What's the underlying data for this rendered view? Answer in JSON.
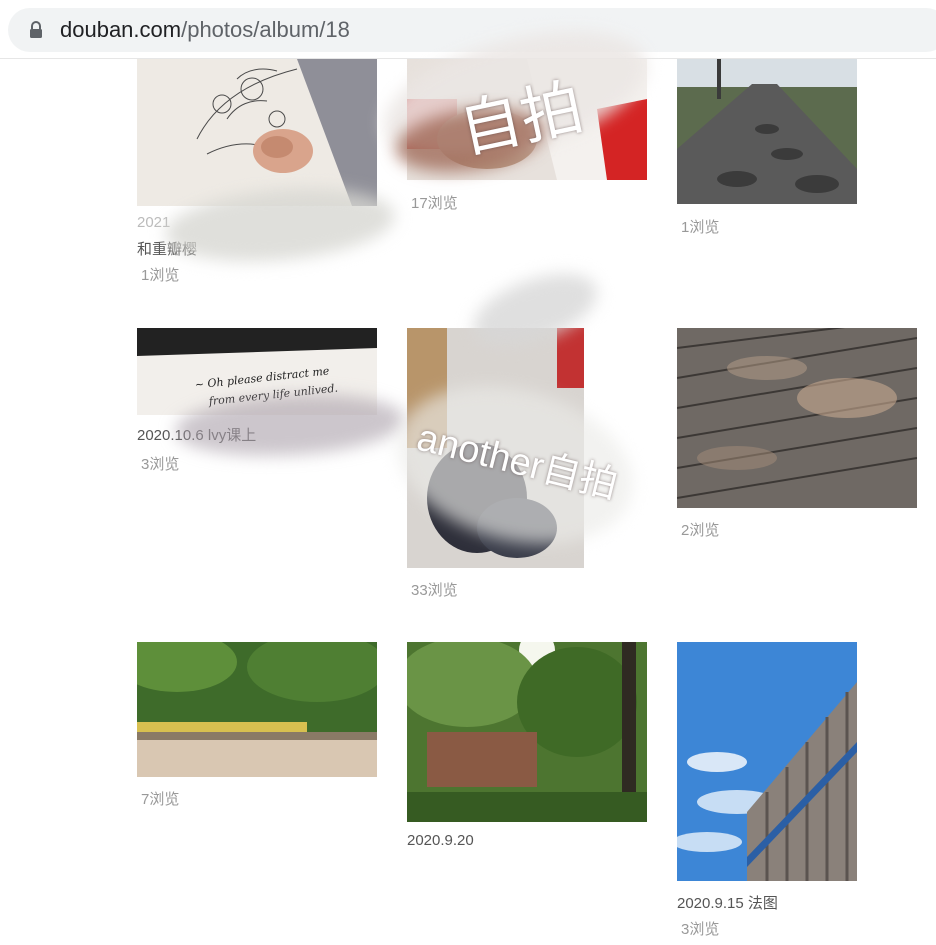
{
  "browser": {
    "url_host": "douban.com",
    "url_path": "/photos/album/18",
    "lock_icon": "lock-icon"
  },
  "photos": [
    {
      "caption_date": "2021",
      "caption": "和重瓣樱",
      "views": "1浏览"
    },
    {
      "caption": "",
      "views": "17浏览"
    },
    {
      "caption": "",
      "views": "1浏览"
    },
    {
      "caption": "2020.10.6 lvy课上",
      "views": "3浏览",
      "image_text": "~ Oh please distract me from every life unlived."
    },
    {
      "caption": "",
      "views": "33浏览"
    },
    {
      "caption": "",
      "views": "2浏览"
    },
    {
      "caption": "",
      "views": "7浏览"
    },
    {
      "caption": "2020.9.20",
      "views": ""
    },
    {
      "caption": "2020.9.15 法图",
      "views": "3浏览"
    }
  ],
  "watermarks": {
    "top": "自拍",
    "middle": "another自拍"
  },
  "colors": {
    "address_bar_bg": "#f1f3f4",
    "views_text": "#999999"
  }
}
